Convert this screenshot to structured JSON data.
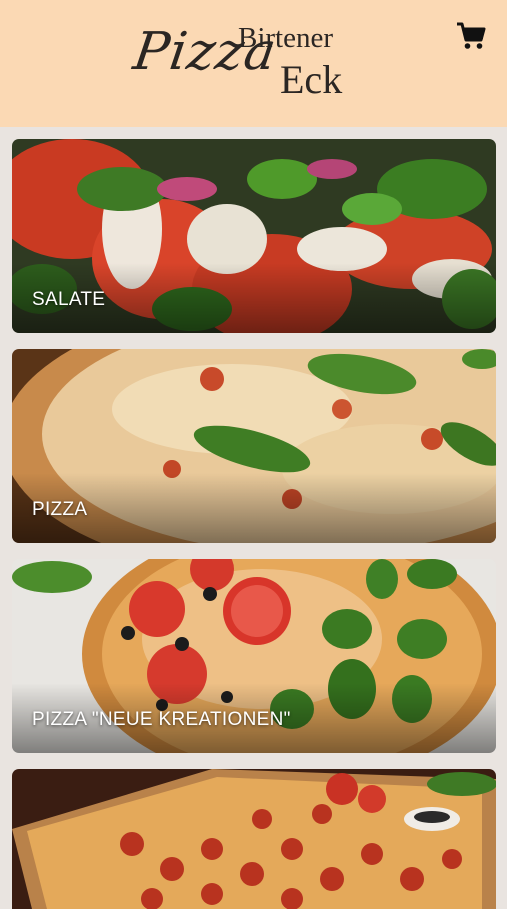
{
  "header": {
    "logo": {
      "script_word": "Pizza",
      "word_top": "Birtener",
      "word_bottom": "Eck"
    },
    "cart_icon": "shopping-cart-icon"
  },
  "categories": [
    {
      "label": "SALATE"
    },
    {
      "label": "PIZZA"
    },
    {
      "label": "PIZZA \"NEUE KREATIONEN\""
    },
    {
      "label": ""
    }
  ],
  "colors": {
    "header_bg": "#fbd9b4",
    "page_bg": "#e9e4e0",
    "logo_text": "#2b2623"
  }
}
